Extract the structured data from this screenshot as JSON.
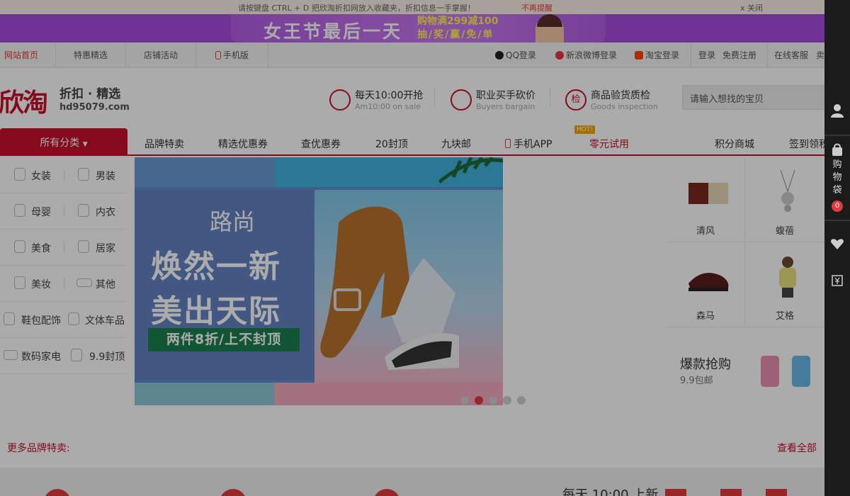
{
  "notice": {
    "message": "请按键盘 CTRL + D 把欣淘折扣网放入收藏夹，折扣信息一手掌握！",
    "no_remind": "不再提醒",
    "close": "x 关闭"
  },
  "promo": {
    "title": "女王节最后一天",
    "line1": "购物满299减100",
    "line2": "抽/奖/赢/免/单"
  },
  "sitenav": {
    "left": [
      "网站首页",
      "特惠精选",
      "店铺活动",
      "手机版"
    ],
    "right": [
      "QQ登录",
      "新浪微博登录",
      "淘宝登录",
      "登录",
      "免费注册",
      "在线客服",
      "卖"
    ]
  },
  "header": {
    "logo": "欣淘",
    "slogan": "折扣 · 精选",
    "domain": "hd95079.com",
    "features": [
      {
        "icon": "clock-icon",
        "glyph": "",
        "title": "每天10:00开抢",
        "sub": "Am10:00 on sale"
      },
      {
        "icon": "lightning-icon",
        "glyph": "",
        "title": "职业买手砍价",
        "sub": "Buyers bargain"
      },
      {
        "icon": "inspection-icon",
        "glyph": "检",
        "title": "商品验货质检",
        "sub": "Goods inspection"
      }
    ],
    "search_placeholder": "请输入想找的宝贝"
  },
  "mainnav": {
    "all": "所有分类",
    "items": [
      "品牌特卖",
      "精选优惠券",
      "查优惠券",
      "20封顶",
      "九块邮",
      "手机APP",
      "零元试用"
    ],
    "hot": "HOT!",
    "right": [
      "积分商城",
      "签到领积"
    ]
  },
  "categories": [
    [
      "女装",
      "男装"
    ],
    [
      "母婴",
      "内衣"
    ],
    [
      "美食",
      "居家"
    ],
    [
      "美妆",
      "其他"
    ],
    [
      "鞋包配饰",
      "文体车品"
    ],
    [
      "数码家电",
      "9.9封顶"
    ]
  ],
  "banner": {
    "brand": "路尚",
    "headline1": "焕然一新",
    "headline2": "美出天际",
    "tag": "两件8折/上不封顶",
    "slides": 5,
    "active_slide": 2
  },
  "products": [
    "清风",
    "蝮蓓",
    "森马",
    "艾格"
  ],
  "hotbuy": {
    "title": "爆款抢购",
    "sub": "9.9包邮"
  },
  "more_brands": "更多品牌特卖:",
  "view_all": "查看全部",
  "bottom_text": "每天 10:00 上新",
  "sidebar": {
    "cart_label": [
      "购",
      "物",
      "袋"
    ],
    "cart_count": "0"
  },
  "colors": {
    "brand_red": "#c8102e",
    "accent_red": "#e4393c",
    "promo_purple": "#a44ddc",
    "sidebar_bg": "#1b1b1b"
  }
}
